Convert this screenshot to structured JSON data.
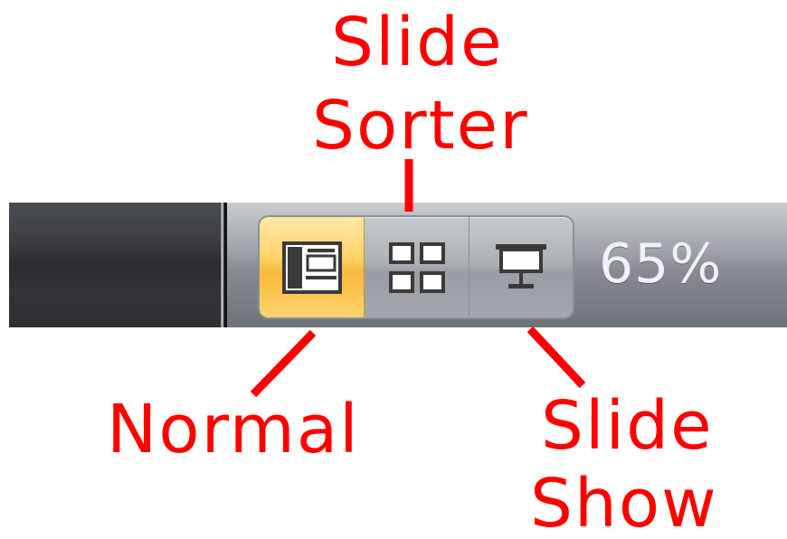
{
  "annotations": {
    "slide_sorter_line1": "Slide",
    "slide_sorter_line2": "Sorter",
    "normal": "Normal",
    "slide_show_line1": "Slide",
    "slide_show_line2": "Show"
  },
  "status_bar": {
    "view_buttons": [
      {
        "name": "Normal",
        "icon": "normal-view-icon",
        "selected": true
      },
      {
        "name": "Slide Sorter",
        "icon": "slide-sorter-icon",
        "selected": false
      },
      {
        "name": "Slide Show",
        "icon": "slide-show-icon",
        "selected": false
      }
    ],
    "zoom_level": "65%"
  },
  "colors": {
    "annotation": "#ff0000",
    "selected_button": "#ffd36a",
    "status_bar_dark": "#2f3134"
  }
}
